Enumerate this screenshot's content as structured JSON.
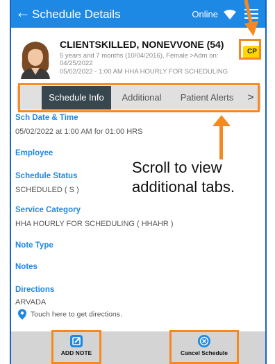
{
  "header": {
    "back_glyph": "←",
    "title": "Schedule Details",
    "status": "Online",
    "icons": [
      "back-arrow-icon",
      "wifi-icon",
      "hamburger-menu-icon"
    ]
  },
  "patient": {
    "name": "CLIENTSKILLED, NONEVVONE (54)",
    "line1": "5 years and 7 months (10/04/2016), Female >Adm on:",
    "line2": "04/25/2022",
    "line3": "05/02/2022 - 1:00 AM HHA HOURLY FOR SCHEDULING",
    "badge": "CP"
  },
  "tabs": [
    {
      "label": "Schedule Info",
      "active": true
    },
    {
      "label": "Additional",
      "active": false
    },
    {
      "label": "Patient Alerts",
      "active": false
    }
  ],
  "tab_more_glyph": ">",
  "details": {
    "sch_date_label": "Sch Date & Time",
    "sch_date_value": "05/02/2022 at 1:00 AM for 01:00 HRS",
    "employee_label": "Employee",
    "status_label": "Schedule Status",
    "status_value": "SCHEDULED ( S )",
    "service_label": "Service Category",
    "service_value": "HHA HOURLY FOR SCHEDULING ( HHAHR )",
    "note_type_label": "Note Type",
    "notes_label": "Notes",
    "directions_label": "Directions",
    "directions_value": "ARVADA",
    "directions_link": "Touch here to get directions."
  },
  "callout": {
    "line1": "Scroll to view",
    "line2": "additional tabs."
  },
  "footer": {
    "add_note": "ADD NOTE",
    "cancel": "Cancel Schedule"
  },
  "colors": {
    "header": "#1e88e5",
    "active_tab": "#37474f",
    "label_blue": "#1e88e5",
    "highlight": "#f5891f",
    "badge": "#ffd600"
  }
}
